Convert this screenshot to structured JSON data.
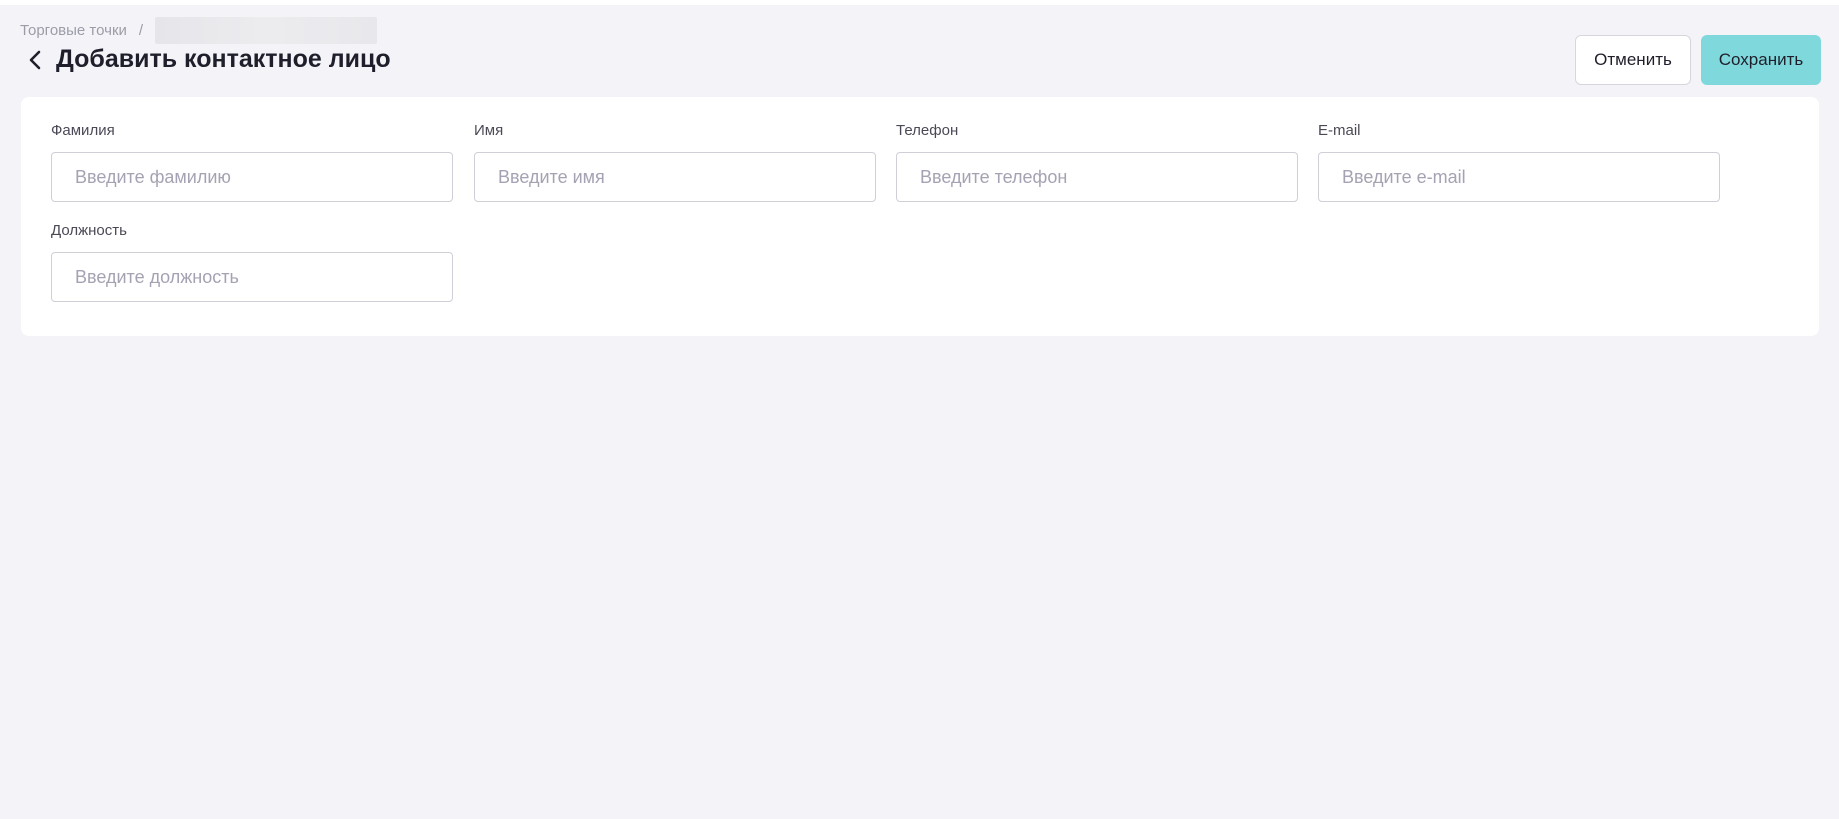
{
  "breadcrumb": {
    "parent": "Торговые точки",
    "separator": "/"
  },
  "header": {
    "title": "Добавить контактное лицо",
    "back_icon": "chevron-left-icon"
  },
  "actions": {
    "cancel_label": "Отменить",
    "save_label": "Сохранить",
    "save_color": "#7fd8dc"
  },
  "form": {
    "last_name": {
      "label": "Фамилия",
      "placeholder": "Введите фамилию",
      "value": ""
    },
    "first_name": {
      "label": "Имя",
      "placeholder": "Введите имя",
      "value": ""
    },
    "phone": {
      "label": "Телефон",
      "placeholder": "Введите телефон",
      "value": ""
    },
    "email": {
      "label": "E-mail",
      "placeholder": "Введите e-mail",
      "value": ""
    },
    "position": {
      "label": "Должность",
      "placeholder": "Введите должность",
      "value": ""
    }
  }
}
